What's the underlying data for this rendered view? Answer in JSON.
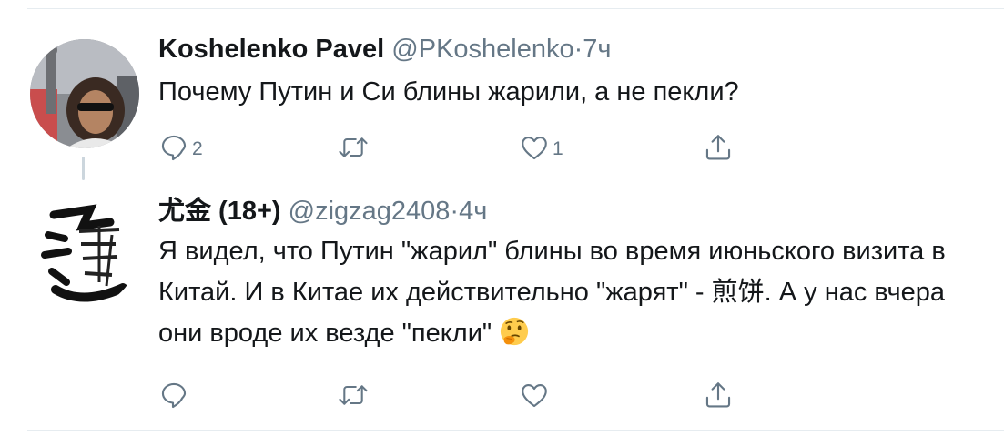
{
  "tweets": [
    {
      "name": "Koshelenko Pavel",
      "handle": "@PKoshelenko",
      "dot": "·",
      "time": "7ч",
      "text": "Почему Путин и Си блины жарили, а не пекли?",
      "replies": "2",
      "retweets": "",
      "likes": "1"
    },
    {
      "name": "尤金 (18+)",
      "handle": "@zigzag2408",
      "dot": "·",
      "time": "4ч",
      "text": "Я видел, что Путин \"жарил\" блины во время июньского визита в Китай. И в Китае их действительно \"жарят\" - 煎饼. А у нас вчера они вроде их везде \"пекли\"",
      "emoji": "thinking-face",
      "replies": "",
      "retweets": "",
      "likes": ""
    }
  ],
  "colors": {
    "name": "#14171a",
    "meta": "#657786",
    "icon": "#657786",
    "divider": "#e6ecf0",
    "thread_line": "#ccd6dd"
  },
  "icons": [
    "reply-icon",
    "retweet-icon",
    "like-icon",
    "share-icon",
    "thinking-face-emoji"
  ]
}
